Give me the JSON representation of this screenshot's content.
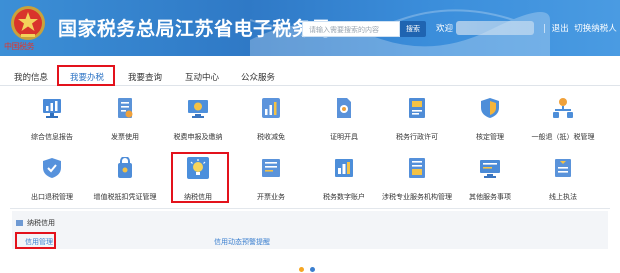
{
  "header": {
    "emblem_caption": "中国税务",
    "title": "国家税务总局江苏省电子税务局",
    "search": {
      "placeholder": "请输入需要搜索的内容",
      "button_label": "搜索"
    },
    "welcome": "欢迎",
    "logout": "退出",
    "switch_taxpayer": "切换纳税人"
  },
  "tabs": [
    {
      "label": "我的信息",
      "active": false
    },
    {
      "label": "我要办税",
      "active": true
    },
    {
      "label": "我要查询",
      "active": false
    },
    {
      "label": "互动中心",
      "active": false
    },
    {
      "label": "公众服务",
      "active": false
    }
  ],
  "grid": {
    "row1": [
      {
        "label": "综合信息报告",
        "icon": "report-chart-icon"
      },
      {
        "label": "发票使用",
        "icon": "invoice-icon"
      },
      {
        "label": "税费申报及缴纳",
        "icon": "monitor-declare-icon"
      },
      {
        "label": "税收减免",
        "icon": "tax-reduction-icon"
      },
      {
        "label": "证明开具",
        "icon": "certificate-icon"
      },
      {
        "label": "税务行政许可",
        "icon": "admin-license-icon"
      },
      {
        "label": "核定管理",
        "icon": "shield-approve-icon"
      },
      {
        "label": "一般退（抵）税管理",
        "icon": "refund-network-icon"
      }
    ],
    "row2": [
      {
        "label": "出口退税管理",
        "icon": "export-shield-icon"
      },
      {
        "label": "增值税抵扣凭证管理",
        "icon": "vat-voucher-icon"
      },
      {
        "label": "纳税信用",
        "icon": "lightbulb-credit-icon"
      },
      {
        "label": "开票业务",
        "icon": "issue-invoice-icon"
      },
      {
        "label": "税务数字账户",
        "icon": "digital-account-icon"
      },
      {
        "label": "涉税专业服务机构管理",
        "icon": "agency-doc-icon"
      },
      {
        "label": "其他服务事项",
        "icon": "other-services-icon"
      },
      {
        "label": "线上执法",
        "icon": "online-law-icon"
      }
    ]
  },
  "subpanel": {
    "title": "纳税信用",
    "links": [
      "信用管理",
      "信用动态预警提醒"
    ]
  },
  "colors": {
    "header_blue": "#2f79c6",
    "accent_blue": "#2c73c4",
    "annotation_red": "#e3121c"
  }
}
